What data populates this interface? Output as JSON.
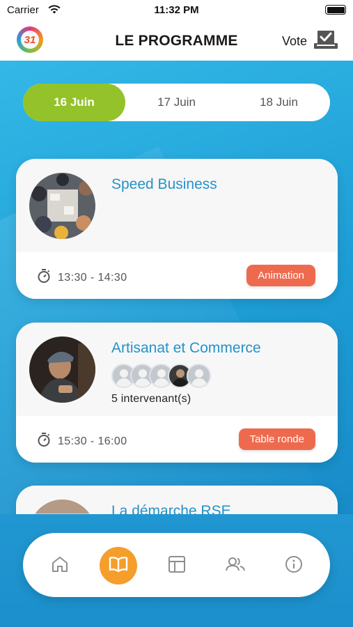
{
  "status_bar": {
    "carrier": "Carrier",
    "time": "11:32 PM"
  },
  "header": {
    "logo_text": "31",
    "title": "LE PROGRAMME",
    "vote_label": "Vote"
  },
  "date_tabs": [
    {
      "label": "16 Juin",
      "active": true
    },
    {
      "label": "17 Juin",
      "active": false
    },
    {
      "label": "18 Juin",
      "active": false
    }
  ],
  "sessions": [
    {
      "title": "Speed Business",
      "time": "13:30 - 14:30",
      "tag": "Animation"
    },
    {
      "title": "Artisanat et Commerce",
      "time": "15:30 - 16:00",
      "tag": "Table ronde",
      "speakers_label": "5 intervenant(s)"
    },
    {
      "title": "La démarche RSE"
    }
  ],
  "colors": {
    "accent_green": "#94c22a",
    "accent_blue": "#2592c8",
    "tag_orange": "#ee6a4f",
    "nav_active": "#f59e2c"
  },
  "nav": [
    "home-icon",
    "book-icon",
    "layout-icon",
    "users-icon",
    "info-icon"
  ]
}
